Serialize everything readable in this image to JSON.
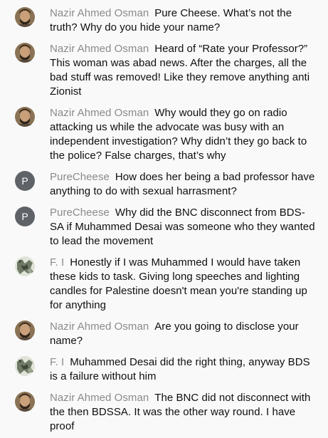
{
  "theme": {
    "background": "#f9f9f9",
    "author_color": "#8a8a8a",
    "text_color": "#0f0f0f",
    "letter_avatar_color": "#5f6368"
  },
  "messages": [
    {
      "author": "Nazir Ahmed Osman",
      "avatar": {
        "type": "photo",
        "icon": "nazir-avatar-photo"
      },
      "text": "Pure Cheese. What’s not the truth? Why do you hide your name?"
    },
    {
      "author": "Nazir Ahmed Osman",
      "avatar": {
        "type": "photo",
        "icon": "nazir-avatar-photo"
      },
      "text": "Heard of “Rate your Professor?” This woman was abad news. After the charges, all the bad stuff was removed! Like they remove anything anti Zionist"
    },
    {
      "author": "Nazir Ahmed Osman",
      "avatar": {
        "type": "photo",
        "icon": "nazir-avatar-photo"
      },
      "text": "Why would they go on radio attacking us while the advocate was busy with an independent investigation? Why didn’t they go back to the police? False charges, that’s why"
    },
    {
      "author": "PureCheese",
      "avatar": {
        "type": "letter",
        "letter": "P"
      },
      "text": "How does her being a bad professor have anything to do with sexual harrasment?"
    },
    {
      "author": "PureCheese",
      "avatar": {
        "type": "letter",
        "letter": "P"
      },
      "text": "Why did the BNC disconnect from BDS-SA if Muhammed Desai was someone who they wanted to lead the movement"
    },
    {
      "author": "F. I",
      "avatar": {
        "type": "photo",
        "icon": "fi-avatar-photo"
      },
      "text": "Honestly if I was Muhammed I would have taken these kids to task. Giving long speeches and lighting candles for Palestine doesn't mean you're standing up for anything"
    },
    {
      "author": "Nazir Ahmed Osman",
      "avatar": {
        "type": "photo",
        "icon": "nazir-avatar-photo"
      },
      "text": "Are you going to disclose your name?"
    },
    {
      "author": "F. I",
      "avatar": {
        "type": "photo",
        "icon": "fi-avatar-photo"
      },
      "text": "Muhammed Desai did the right thing, anyway BDS is a failure without him"
    },
    {
      "author": "Nazir Ahmed Osman",
      "avatar": {
        "type": "photo",
        "icon": "nazir-avatar-photo"
      },
      "text": "The BNC did not disconnect with the then BDSSA. It was the other way round. I have proof"
    }
  ]
}
